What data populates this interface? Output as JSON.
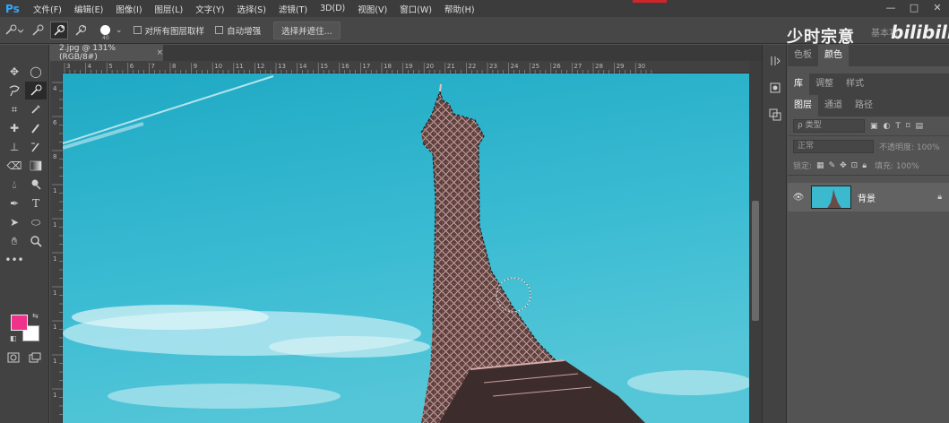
{
  "app": {
    "logo": "Ps"
  },
  "menu": [
    "文件(F)",
    "编辑(E)",
    "图像(I)",
    "图层(L)",
    "文字(Y)",
    "选择(S)",
    "滤镜(T)",
    "3D(D)",
    "视图(V)",
    "窗口(W)",
    "帮助(H)"
  ],
  "window_controls": {
    "minimize": "—",
    "maximize": "□",
    "close": "✕"
  },
  "options": {
    "brush_size": "40",
    "sample_all_layers": "对所有图层取样",
    "auto_enhance": "自动增强",
    "select_mask_button": "选择并遮住..."
  },
  "watermark": {
    "text": "少时宗意",
    "sub": "基本功",
    "bilibili": "bilibili"
  },
  "document": {
    "tab_title": "2.jpg @ 131%(RGB/8#)",
    "close": "×"
  },
  "ruler": {
    "h_ticks": [
      "3",
      "4",
      "5",
      "6",
      "7",
      "8",
      "9",
      "10",
      "11",
      "12",
      "13",
      "14",
      "15",
      "16",
      "17",
      "18",
      "19",
      "20",
      "21",
      "22",
      "23",
      "24",
      "25",
      "26",
      "27",
      "28",
      "29",
      "30"
    ],
    "v_ticks": [
      "4",
      "6",
      "8",
      "1",
      "1",
      "1",
      "1",
      "1",
      "1",
      "1",
      "2"
    ]
  },
  "colors": {
    "foreground": "#f0338a",
    "background": "#ffffff",
    "sky": "#3bb9cf",
    "accent_blue": "#31a8ff"
  },
  "panels": {
    "color_tabs": [
      "色板",
      "颜色"
    ],
    "library_tabs": [
      "库",
      "调整",
      "样式"
    ],
    "layer_tabs": [
      "图层",
      "通道",
      "路径"
    ],
    "filter_placeholder": "类型",
    "blend_mode": "正常",
    "opacity_label": "不透明度: 100%",
    "lock_label": "锁定:",
    "fill_label": "填充: 100%",
    "layers": [
      {
        "name": "背景",
        "visible": true,
        "locked": true
      }
    ]
  }
}
